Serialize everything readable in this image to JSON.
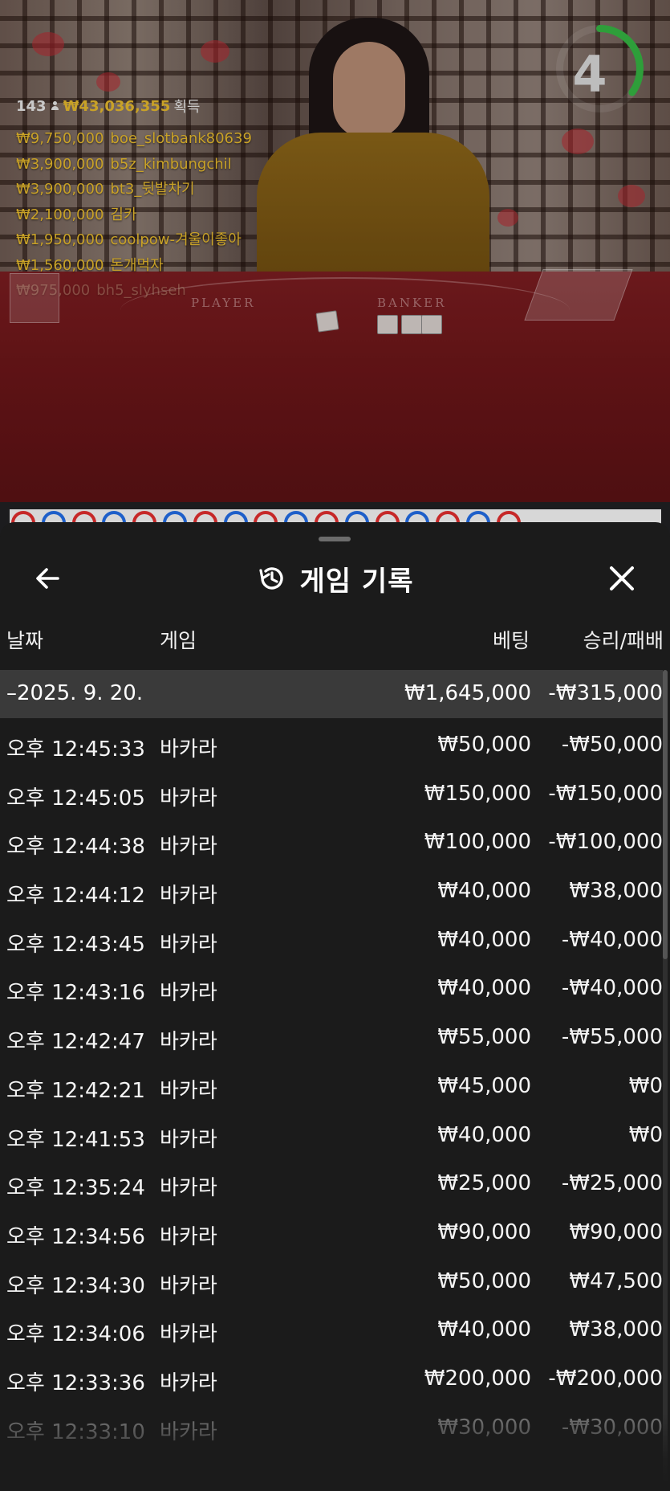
{
  "overlay": {
    "players": "143",
    "total_won": "₩43,036,355",
    "won_label": "획득",
    "winners": [
      {
        "amount": "₩9,750,000",
        "name": "boe_slotbank80639"
      },
      {
        "amount": "₩3,900,000",
        "name": "b5z_kimbungchil"
      },
      {
        "amount": "₩3,900,000",
        "name": "bt3_뒷발차기"
      },
      {
        "amount": "₩2,100,000",
        "name": "김카"
      },
      {
        "amount": "₩1,950,000",
        "name": "coolpow-겨울이좋아"
      },
      {
        "amount": "₩1,560,000",
        "name": "돈개먹자"
      },
      {
        "amount": "₩975,000",
        "name": "bh5_slyhseh"
      }
    ],
    "countdown": "4",
    "countdown_fraction": 0.35,
    "table_labels": {
      "player": "PLAYER",
      "banker": "BANKER"
    }
  },
  "colors": {
    "gold": "#c9a227",
    "timer_green": "#2e9e3a",
    "road_red": "#c62828",
    "road_blue": "#1e5fc9",
    "sheet_bg": "#1b1b1b",
    "date_row_bg": "#3a3a3a"
  },
  "roadmap": [
    "red",
    "blue",
    "red",
    "blue",
    "red",
    "blue",
    "red",
    "blue",
    "red",
    "blue",
    "red",
    "blue",
    "red",
    "blue",
    "red",
    "blue",
    "red"
  ],
  "sheet": {
    "title": "게임 기록",
    "icons": {
      "back": "arrow-left-icon",
      "history": "history-icon",
      "close": "close-icon"
    },
    "columns": {
      "date": "날짜",
      "game": "게임",
      "bet": "베팅",
      "result": "승리/패배"
    },
    "date_group": {
      "date": "–2025. 9. 20.",
      "bet": "₩1,645,000",
      "result": "-₩315,000"
    },
    "rows": [
      {
        "time": "오후 12:45:33",
        "game": "바카라",
        "bet": "₩50,000",
        "result": "-₩50,000"
      },
      {
        "time": "오후 12:45:05",
        "game": "바카라",
        "bet": "₩150,000",
        "result": "-₩150,000"
      },
      {
        "time": "오후 12:44:38",
        "game": "바카라",
        "bet": "₩100,000",
        "result": "-₩100,000"
      },
      {
        "time": "오후 12:44:12",
        "game": "바카라",
        "bet": "₩40,000",
        "result": "₩38,000"
      },
      {
        "time": "오후 12:43:45",
        "game": "바카라",
        "bet": "₩40,000",
        "result": "-₩40,000"
      },
      {
        "time": "오후 12:43:16",
        "game": "바카라",
        "bet": "₩40,000",
        "result": "-₩40,000"
      },
      {
        "time": "오후 12:42:47",
        "game": "바카라",
        "bet": "₩55,000",
        "result": "-₩55,000"
      },
      {
        "time": "오후 12:42:21",
        "game": "바카라",
        "bet": "₩45,000",
        "result": "₩0"
      },
      {
        "time": "오후 12:41:53",
        "game": "바카라",
        "bet": "₩40,000",
        "result": "₩0"
      },
      {
        "time": "오후 12:35:24",
        "game": "바카라",
        "bet": "₩25,000",
        "result": "-₩25,000"
      },
      {
        "time": "오후 12:34:56",
        "game": "바카라",
        "bet": "₩90,000",
        "result": "₩90,000"
      },
      {
        "time": "오후 12:34:30",
        "game": "바카라",
        "bet": "₩50,000",
        "result": "₩47,500"
      },
      {
        "time": "오후 12:34:06",
        "game": "바카라",
        "bet": "₩40,000",
        "result": "₩38,000"
      },
      {
        "time": "오후 12:33:36",
        "game": "바카라",
        "bet": "₩200,000",
        "result": "-₩200,000"
      },
      {
        "time": "오후 12:33:10",
        "game": "바카라",
        "bet": "₩30,000",
        "result": "-₩30,000"
      }
    ]
  }
}
